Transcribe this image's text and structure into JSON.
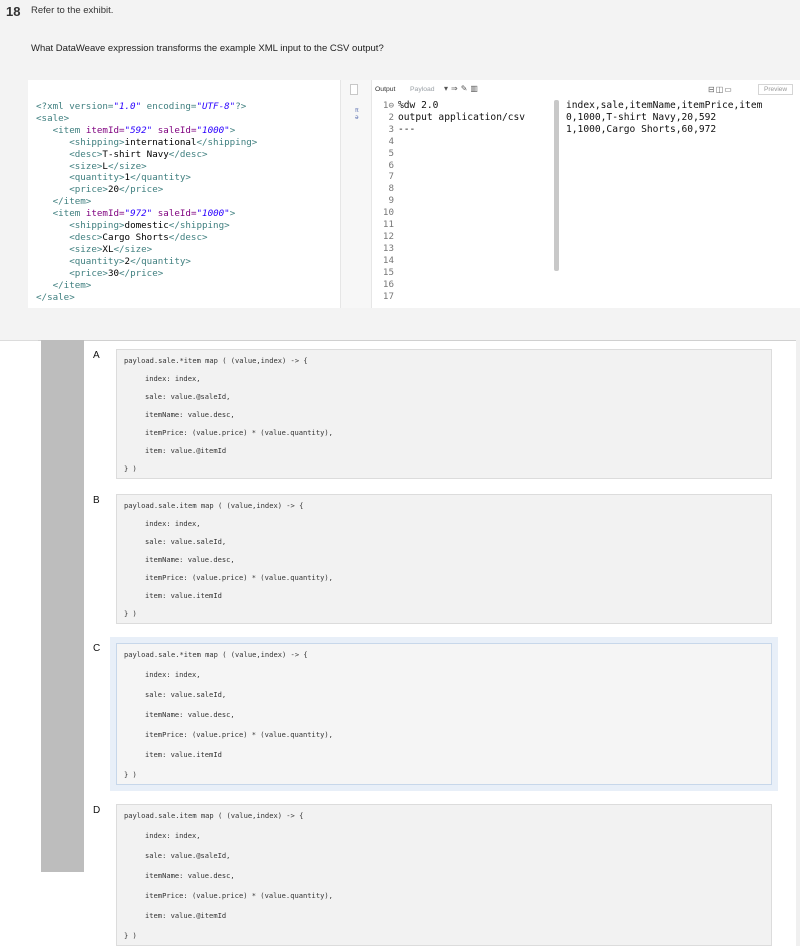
{
  "question": {
    "number": "18",
    "refer": "Refer to the exhibit.",
    "text": "What DataWeave expression transforms the example XML input to the CSV output?"
  },
  "exhibit": {
    "editor_header": {
      "output_label": "Output",
      "payload_label": "Payload",
      "preview_label": "Preview",
      "icons": [
        "dropdown-arrow-icon",
        "arrow-right-icon",
        "pencil-icon",
        "trash-icon"
      ]
    },
    "line_numbers": [
      "1",
      "2",
      "3",
      "4",
      "5",
      "6",
      "7",
      "8",
      "9",
      "10",
      "11",
      "12",
      "13",
      "14",
      "15",
      "16",
      "17"
    ],
    "code_lines": [
      "%dw 2.0",
      "output application/csv",
      "---"
    ],
    "csv_lines": [
      "index,sale,itemName,itemPrice,item",
      "0,1000,T-shirt Navy,20,592",
      "1,1000,Cargo Shorts,60,972"
    ],
    "xml": {
      "decl": "<?xml version=\"1.0\" encoding=\"UTF-8\"?>",
      "items": [
        {
          "itemId": "592",
          "saleId": "1000",
          "shipping": "international",
          "desc": "T-shirt Navy",
          "size": "L",
          "quantity": "1",
          "price": "20"
        },
        {
          "itemId": "972",
          "saleId": "1000",
          "shipping": "domestic",
          "desc": "Cargo Shorts",
          "size": "XL",
          "quantity": "2",
          "price": "30"
        }
      ]
    }
  },
  "options": [
    {
      "letter": "A",
      "lines": [
        "payload.sale.*item map ( (value,index) -> {",
        "index: index,",
        "sale: value.@saleId,",
        "itemName: value.desc,",
        "itemPrice: (value.price) * (value.quantity),",
        "item: value.@itemId",
        "} )"
      ]
    },
    {
      "letter": "B",
      "lines": [
        "payload.sale.item map ( (value,index) -> {",
        "index: index,",
        "sale: value.saleId,",
        "itemName: value.desc,",
        "itemPrice: (value.price) * (value.quantity),",
        "item: value.itemId",
        "} )"
      ]
    },
    {
      "letter": "C",
      "lines": [
        "payload.sale.*item map ( (value,index) -> {",
        "index: index,",
        "sale: value.saleId,",
        "itemName: value.desc,",
        "itemPrice: (value.price) * (value.quantity),",
        "item: value.itemId",
        "} )"
      ]
    },
    {
      "letter": "D",
      "lines": [
        "payload.sale.item map ( (value,index) -> {",
        "index: index,",
        "sale: value.@saleId,",
        "itemName: value.desc,",
        "itemPrice: (value.price) * (value.quantity),",
        "item: value.@itemId",
        "} )"
      ]
    }
  ]
}
